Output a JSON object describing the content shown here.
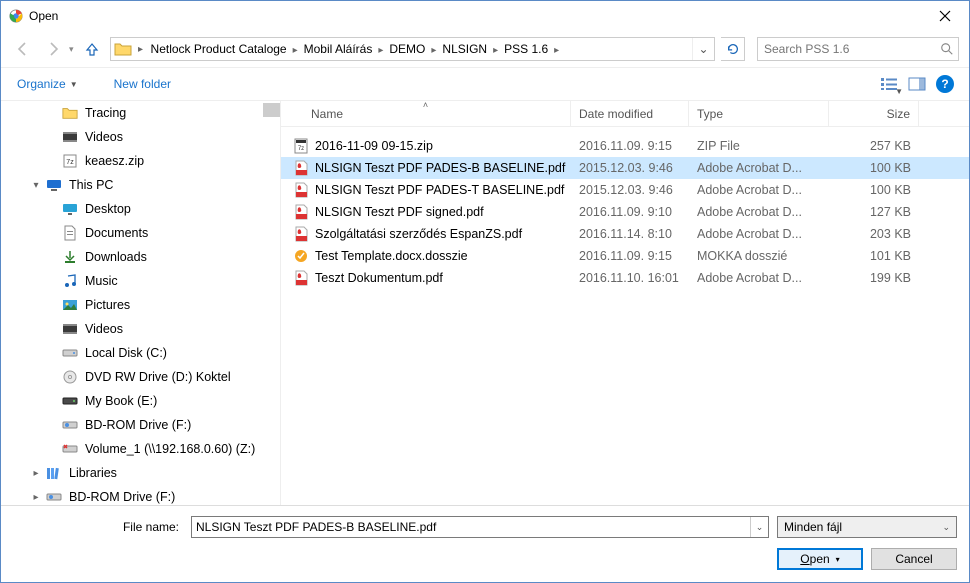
{
  "window": {
    "title": "Open"
  },
  "breadcrumb": {
    "segments": [
      "Netlock Product Cataloge",
      "Mobil Aláírás",
      "DEMO",
      "NLSIGN",
      "PSS 1.6"
    ]
  },
  "search": {
    "placeholder": "Search PSS 1.6"
  },
  "toolbar": {
    "organize": "Organize",
    "new_folder": "New folder"
  },
  "tree": {
    "items": [
      {
        "label": "Tracing",
        "icon": "folder",
        "indent": 2,
        "exp": ""
      },
      {
        "label": "Videos",
        "icon": "videos",
        "indent": 2,
        "exp": ""
      },
      {
        "label": "keaesz.zip",
        "icon": "zip",
        "indent": 2,
        "exp": ""
      },
      {
        "label": "This PC",
        "icon": "pc",
        "indent": 1,
        "exp": "▾"
      },
      {
        "label": "Desktop",
        "icon": "desktop",
        "indent": 2,
        "exp": ""
      },
      {
        "label": "Documents",
        "icon": "documents",
        "indent": 2,
        "exp": ""
      },
      {
        "label": "Downloads",
        "icon": "downloads",
        "indent": 2,
        "exp": ""
      },
      {
        "label": "Music",
        "icon": "music",
        "indent": 2,
        "exp": ""
      },
      {
        "label": "Pictures",
        "icon": "pictures",
        "indent": 2,
        "exp": ""
      },
      {
        "label": "Videos",
        "icon": "videos",
        "indent": 2,
        "exp": ""
      },
      {
        "label": "Local Disk (C:)",
        "icon": "disk",
        "indent": 2,
        "exp": ""
      },
      {
        "label": "DVD RW Drive (D:) Koktel",
        "icon": "dvd",
        "indent": 2,
        "exp": ""
      },
      {
        "label": "My Book (E:)",
        "icon": "ext",
        "indent": 2,
        "exp": ""
      },
      {
        "label": "BD-ROM Drive (F:)",
        "icon": "bd",
        "indent": 2,
        "exp": ""
      },
      {
        "label": "Volume_1 (\\\\192.168.0.60) (Z:)",
        "icon": "net",
        "indent": 2,
        "exp": ""
      },
      {
        "label": "Libraries",
        "icon": "libraries",
        "indent": 1,
        "exp": "▸"
      },
      {
        "label": "BD-ROM Drive (F:)",
        "icon": "bd",
        "indent": 1,
        "exp": "▸"
      }
    ]
  },
  "columns": {
    "name": "Name",
    "date": "Date modified",
    "type": "Type",
    "size": "Size"
  },
  "files": [
    {
      "name": "2016-11-09 09-15.zip",
      "date": "2016.11.09. 9:15",
      "type": "ZIP File",
      "size": "257 KB",
      "icon": "zip",
      "selected": false
    },
    {
      "name": "NLSIGN Teszt PDF PADES-B BASELINE.pdf",
      "date": "2015.12.03. 9:46",
      "type": "Adobe Acrobat D...",
      "size": "100 KB",
      "icon": "pdf",
      "selected": true
    },
    {
      "name": "NLSIGN Teszt PDF PADES-T BASELINE.pdf",
      "date": "2015.12.03. 9:46",
      "type": "Adobe Acrobat D...",
      "size": "100 KB",
      "icon": "pdf",
      "selected": false
    },
    {
      "name": "NLSIGN Teszt PDF signed.pdf",
      "date": "2016.11.09. 9:10",
      "type": "Adobe Acrobat D...",
      "size": "127 KB",
      "icon": "pdf",
      "selected": false
    },
    {
      "name": "Szolgáltatási szerződés EspanZS.pdf",
      "date": "2016.11.14. 8:10",
      "type": "Adobe Acrobat D...",
      "size": "203 KB",
      "icon": "pdf",
      "selected": false
    },
    {
      "name": "Test Template.docx.dosszie",
      "date": "2016.11.09. 9:15",
      "type": "MOKKA dosszié",
      "size": "101 KB",
      "icon": "dosszie",
      "selected": false
    },
    {
      "name": "Teszt Dokumentum.pdf",
      "date": "2016.11.10. 16:01",
      "type": "Adobe Acrobat D...",
      "size": "199 KB",
      "icon": "pdf",
      "selected": false
    }
  ],
  "footer": {
    "filename_label": "File name:",
    "filename_value": "NLSIGN Teszt PDF PADES-B BASELINE.pdf",
    "filter_label": "Minden fájl",
    "open": "Open",
    "cancel": "Cancel"
  }
}
